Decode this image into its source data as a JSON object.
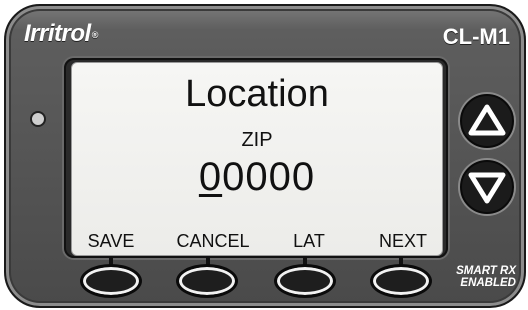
{
  "brand": {
    "name": "Irritrol",
    "mark": "®"
  },
  "model": "CL-M1",
  "screen": {
    "title": "Location",
    "field_label": "ZIP",
    "value_cursor": "0",
    "value_rest": "0000",
    "softkeys": [
      "SAVE",
      "CANCEL",
      "LAT",
      "NEXT"
    ]
  },
  "badge": {
    "line1": "SMART RX",
    "line2": "ENABLED"
  },
  "buttons": {
    "up": "up-arrow-icon",
    "down": "down-arrow-icon"
  }
}
